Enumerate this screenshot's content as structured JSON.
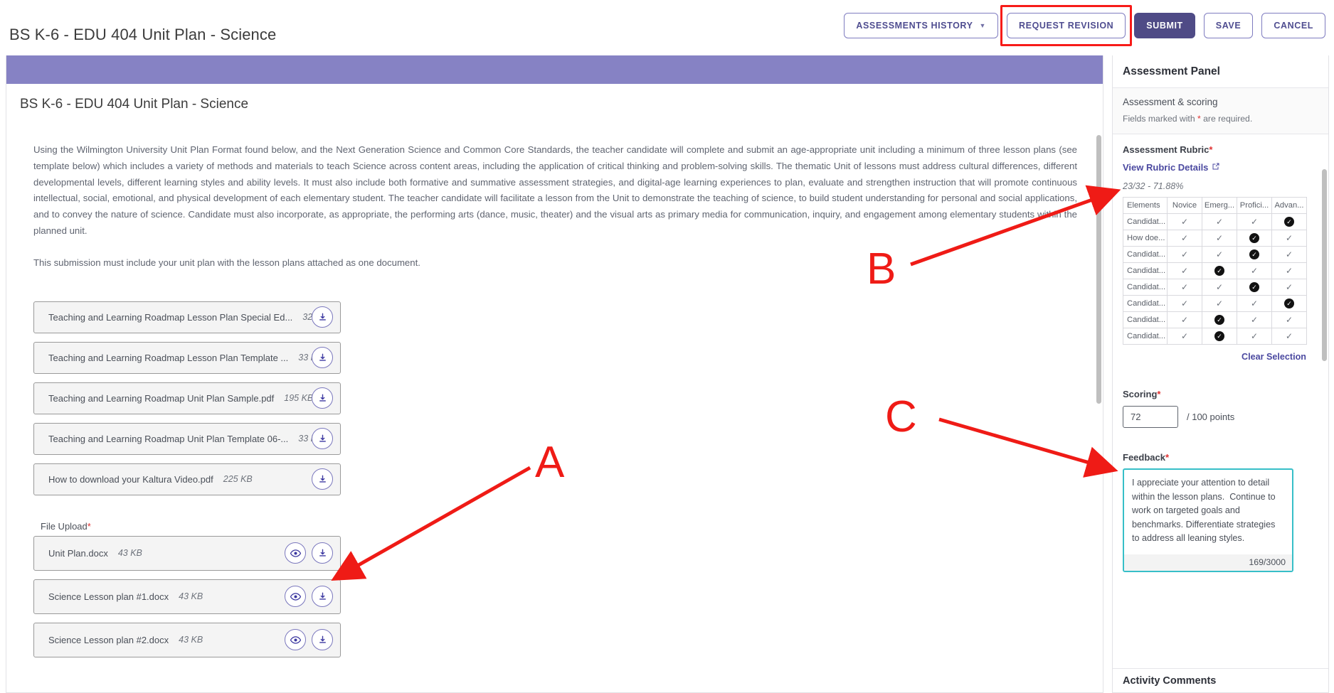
{
  "header": {
    "title": "BS K-6 - EDU 404 Unit Plan - Science",
    "buttons": {
      "assessments_history": "ASSESSMENTS HISTORY",
      "request_revision": "REQUEST REVISION",
      "submit": "SUBMIT",
      "save": "SAVE",
      "cancel": "CANCEL"
    },
    "highlight_color": "#f71b18",
    "primary_color": "#4f4b86"
  },
  "main": {
    "doc_title": "BS K-6 - EDU 404 Unit Plan - Science",
    "paragraph1": "Using the Wilmington University Unit Plan Format found below, and the Next Generation Science and Common Core Standards, the teacher candidate will complete and submit an age-appropriate unit including a minimum of three lesson plans (see template below) which includes a variety of methods and materials to teach Science across content areas, including the application of critical thinking and problem-solving skills. The thematic Unit of lessons must address cultural differences, different developmental levels, different learning styles and ability levels.  It must also include both formative and summative assessment strategies, and digital-age learning experiences to plan, evaluate and strengthen instruction that will promote continuous intellectual, social, emotional, and physical development of each elementary student.   The teacher candidate will facilitate a lesson from the Unit to demonstrate the teaching of science, to build student understanding for personal and social applications, and to convey the nature of science.  Candidate must also incorporate, as appropriate, the performing arts (dance, music, theater) and the visual arts as primary media for communication, inquiry, and engagement among elementary students within the planned unit.",
    "paragraph2": "This submission must include your unit plan with the lesson plans attached as one document.",
    "resource_files": [
      {
        "name": "Teaching and Learning Roadmap Lesson Plan Special Ed...",
        "size": "32 KB"
      },
      {
        "name": "Teaching and Learning Roadmap Lesson Plan Template ...",
        "size": "33 KB"
      },
      {
        "name": "Teaching and Learning Roadmap Unit Plan Sample.pdf",
        "size": "195 KB"
      },
      {
        "name": "Teaching and Learning Roadmap Unit Plan Template 06-...",
        "size": "33 KB"
      },
      {
        "name": "How to download your Kaltura Video.pdf",
        "size": "225 KB"
      }
    ],
    "upload_label": "File Upload",
    "upload_required_mark": "*",
    "uploaded_files": [
      {
        "name": "Unit Plan.docx",
        "size": "43 KB"
      },
      {
        "name": "Science Lesson plan #1.docx",
        "size": "43 KB"
      },
      {
        "name": "Science Lesson plan #2.docx",
        "size": "43 KB"
      }
    ]
  },
  "panel": {
    "title": "Assessment Panel",
    "section_title": "Assessment & scoring",
    "required_note_pre": "Fields marked with ",
    "required_note_mark": "*",
    "required_note_post": " are required.",
    "rubric_label": "Assessment Rubric",
    "rubric_required_mark": "*",
    "view_rubric_link": "View Rubric Details",
    "rubric_score_text": "23/32 - 71.88%",
    "rubric_columns": [
      "Elements",
      "Novice",
      "Emerg...",
      "Profici...",
      "Advan..."
    ],
    "rubric_rows": [
      {
        "element": "Candidat...",
        "selected": 4
      },
      {
        "element": "How doe...",
        "selected": 3
      },
      {
        "element": "Candidat...",
        "selected": 3
      },
      {
        "element": "Candidat...",
        "selected": 2
      },
      {
        "element": "Candidat...",
        "selected": 3
      },
      {
        "element": "Candidat...",
        "selected": 4
      },
      {
        "element": "Candidat...",
        "selected": 2
      },
      {
        "element": "Candidat...",
        "selected": 2
      }
    ],
    "clear_selection": "Clear Selection",
    "scoring_label": "Scoring",
    "scoring_required_mark": "*",
    "score_value": "72",
    "score_unit": "/ 100 points",
    "feedback_label": "Feedback",
    "feedback_required_mark": "*",
    "feedback_text": "I appreciate your attention to detail within the lesson plans.  Continue to work on targeted goals and benchmarks. Differentiate strategies to address all leaning styles.",
    "feedback_count": "169/3000",
    "feedback_border_color": "#37bfc8",
    "activity_comments": "Activity Comments"
  },
  "annotations": {
    "color": "#ef1b16",
    "labels": [
      {
        "id": "A",
        "text": "A"
      },
      {
        "id": "B",
        "text": "B"
      },
      {
        "id": "C",
        "text": "C"
      }
    ]
  }
}
